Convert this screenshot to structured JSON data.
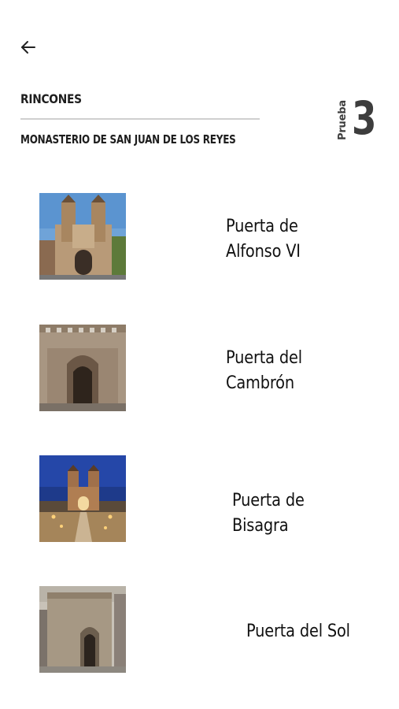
{
  "header": {
    "section_title": "RINCONES",
    "subtitle": "MONASTERIO DE SAN JUAN DE LOS REYES",
    "badge_word": "Prueba",
    "badge_number": "3"
  },
  "icons": {
    "back": "arrow-left-icon"
  },
  "items": [
    {
      "label": "Puerta de Alfonso VI"
    },
    {
      "label": "Puerta del Cambrón"
    },
    {
      "label": "Puerta de Bisagra"
    },
    {
      "label": "Puerta del Sol"
    }
  ]
}
